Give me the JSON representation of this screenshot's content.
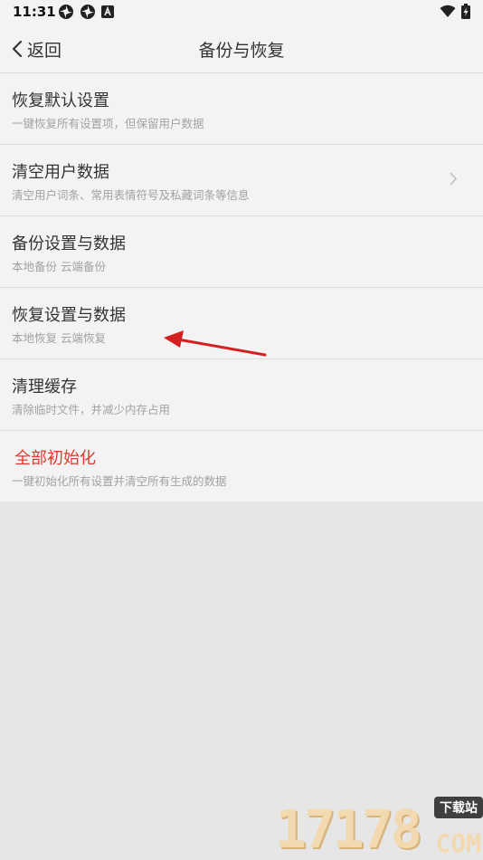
{
  "status_bar": {
    "time": "11:31"
  },
  "header": {
    "back_label": "返回",
    "title": "备份与恢复"
  },
  "items": [
    {
      "title": "恢复默认设置",
      "subtitle": "一键恢复所有设置项，但保留用户数据"
    },
    {
      "title": "清空用户数据",
      "subtitle": "清空用户词条、常用表情符号及私藏词条等信息"
    },
    {
      "title": "备份设置与数据",
      "subtitle": "本地备份 云端备份"
    },
    {
      "title": "恢复设置与数据",
      "subtitle": "本地恢复 云端恢复"
    },
    {
      "title": "清理缓存",
      "subtitle": "清除临时文件，并减少内存占用"
    },
    {
      "title": "全部初始化",
      "subtitle": "一键初始化所有设置并清空所有生成的数据"
    }
  ],
  "watermark": {
    "number": "17178",
    "badge": "下载站",
    "suffix": "COM"
  },
  "colors": {
    "danger": "#e23a2e",
    "annotation_arrow": "#d42020"
  }
}
